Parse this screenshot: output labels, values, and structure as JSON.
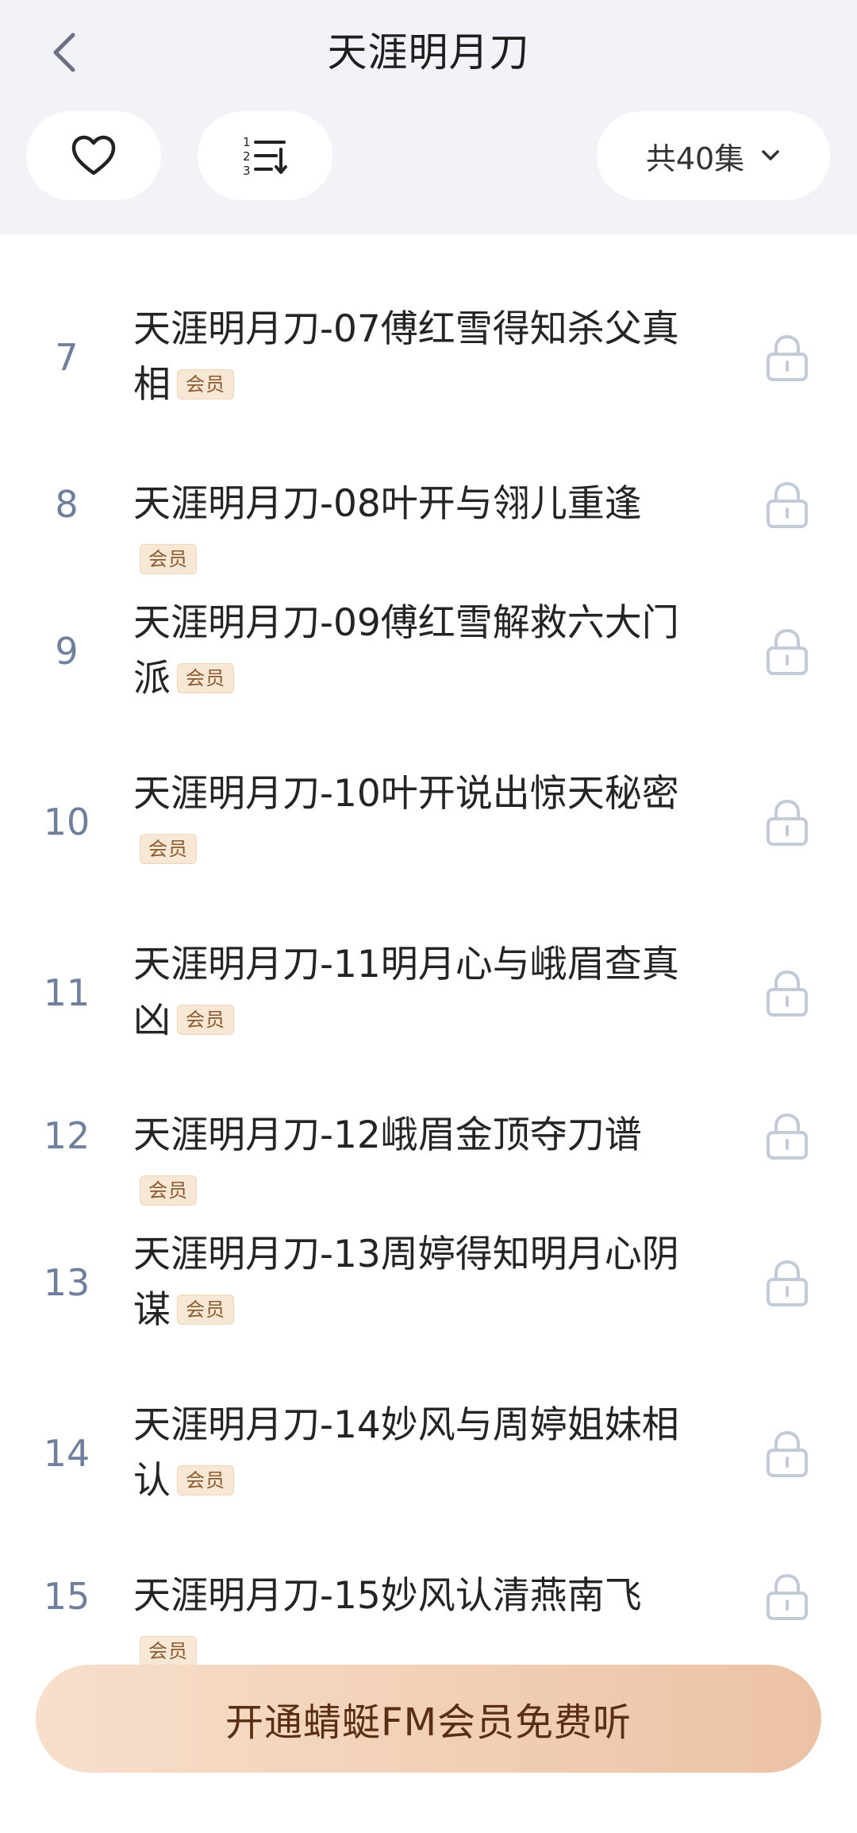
{
  "header": {
    "title": "天涯明月刀",
    "back_icon": "chevron-left-icon",
    "favorite_icon": "heart-icon",
    "sort_icon": "sort-order-icon",
    "episode_count_label": "共40集"
  },
  "badge_label": "会员",
  "episodes": [
    {
      "number": "7",
      "title": "天涯明月刀-07傅红雪得知杀父真相"
    },
    {
      "number": "8",
      "title": "天涯明月刀-08叶开与翎儿重逢"
    },
    {
      "number": "9",
      "title": "天涯明月刀-09傅红雪解救六大门派"
    },
    {
      "number": "10",
      "title": "天涯明月刀-10叶开说出惊天秘密"
    },
    {
      "number": "11",
      "title": "天涯明月刀-11明月心与峨眉查真凶"
    },
    {
      "number": "12",
      "title": "天涯明月刀-12峨眉金顶夺刀谱"
    },
    {
      "number": "13",
      "title": "天涯明月刀-13周婷得知明月心阴谋"
    },
    {
      "number": "14",
      "title": "天涯明月刀-14妙风与周婷姐妹相认"
    },
    {
      "number": "15",
      "title": "天涯明月刀-15妙风认清燕南飞"
    }
  ],
  "cta_label": "开通蜻蜓FM会员免费听",
  "colors": {
    "header_bg": "#f1f3f8",
    "episode_number": "#6f7f9c",
    "badge_text": "#8d5a2e",
    "badge_bg": "#f7e7d5",
    "cta_text": "#5a2e14",
    "lock": "#c3cad8"
  }
}
